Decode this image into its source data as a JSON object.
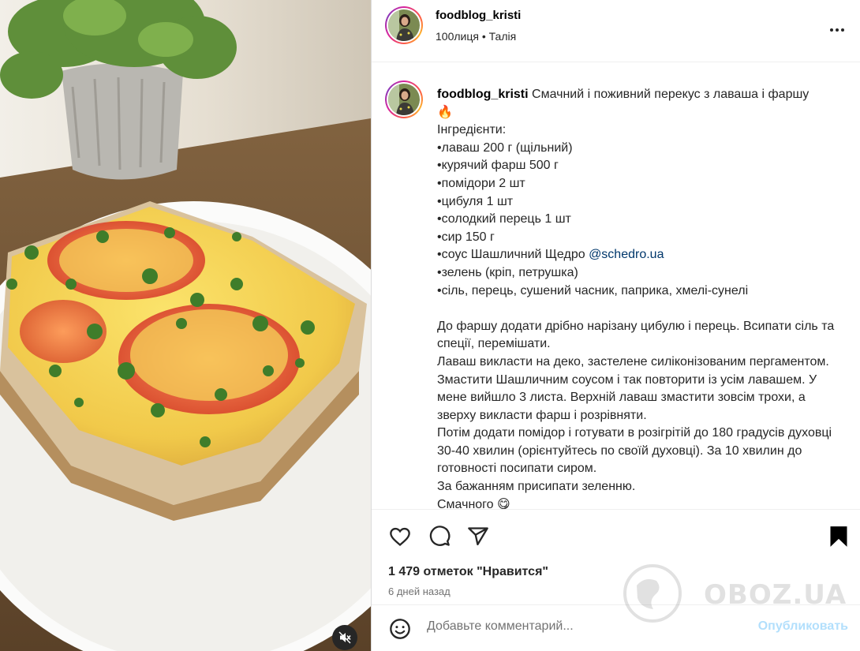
{
  "post": {
    "username": "foodblog_kristi",
    "subline": "100лиця • Талія",
    "caption_first": " Смачний і поживний перекус з лаваша і фаршу",
    "caption_emoji": "🔥",
    "caption_lines_1": "Інгредієнти:\n•лаваш 200 г (щільний)\n•курячий фарш 500 г\n•помідори 2 шт\n•цибуля 1 шт\n•солодкий перець 1 шт\n•сир 150 г\n•соус Шашличний Щедро ",
    "mention": "@schedro.ua",
    "caption_lines_2": "\n•зелень (кріп, петрушка)\n•сіль, перець, сушений часник, паприка, хмелі-сунелі\n\nДо фаршу додати дрібно нарізану цибулю і перець. Всипати сіль та спеції, перемішати.\nЛаваш викласти на деко, застелене силіконізованим пергаментом. Змастити Шашличним соусом і так повторити із усім лавашем. У мене вийшло 3 листа. Верхній лаваш змастити зовсім трохи, а зверху викласти фарш і розрівняти.\nПотім додати помідор і готувати в розігрітій до 180 градусів духовці 30-40 хвилин (орієнтуйтесь по своїй духовці). За 10 хвилин до готовності посипати сиром.\nЗа бажанням присипати зеленню.\nСмачного ",
    "caption_end_emoji": "😋",
    "likes": "1 479 отметок \"Нравится\"",
    "time_ago": "6 дней назад"
  },
  "comment": {
    "placeholder": "Добавьте комментарий...",
    "publish_label": "Опубликовать"
  },
  "watermark": {
    "text": "OBOZ.UA"
  },
  "icons": {
    "more": "more-horizontal-icon",
    "like": "heart-icon",
    "comment": "comment-bubble-icon",
    "share": "paper-plane-icon",
    "save": "bookmark-filled-icon",
    "emoji": "smiley-icon",
    "mute": "speaker-muted-icon"
  }
}
